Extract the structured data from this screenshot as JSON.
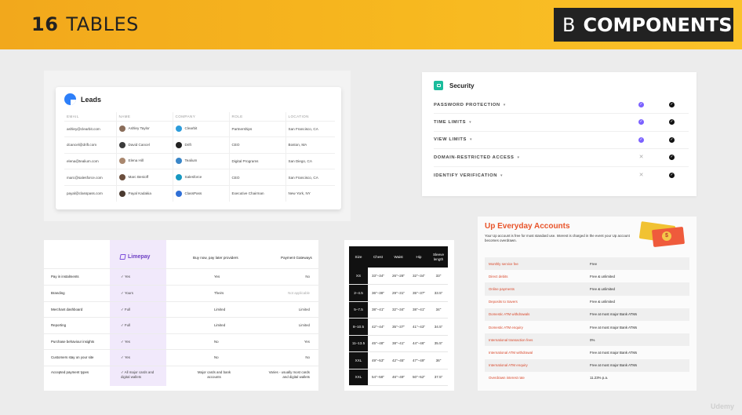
{
  "banner": {
    "number": "16",
    "title": "TABLES",
    "section_letter": "B",
    "section_title": "COMPONENTS",
    "accent": "#f5b01d"
  },
  "leads": {
    "title": "Leads",
    "columns": [
      "EMAIL",
      "NAME",
      "COMPANY",
      "ROLE",
      "LOCATION"
    ],
    "rows": [
      {
        "email": "ashley@clearbit.com",
        "name": "Ashley Taylor",
        "company": "Clearbit",
        "role": "Partnerships",
        "location": "San Francisco, CA",
        "logo_color": "#2d9cdb"
      },
      {
        "email": "dcancel@drift.com",
        "name": "David Cancel",
        "company": "Drift",
        "role": "CEO",
        "location": "Boston, MA",
        "logo_color": "#222222"
      },
      {
        "email": "elena@tealium.com",
        "name": "Elena Hill",
        "company": "Tealium",
        "role": "Digital Programs",
        "location": "San Diego, CA",
        "logo_color": "#3a86c8"
      },
      {
        "email": "marc@salesforce.com",
        "name": "Marc Benioff",
        "company": "Salesforce",
        "role": "CEO",
        "location": "San Francisco, CA",
        "logo_color": "#1798c1"
      },
      {
        "email": "payal@classpass.com",
        "name": "Payal Kadakia",
        "company": "ClassPass",
        "role": "Executive Chairman",
        "location": "New York, NY",
        "logo_color": "#2f6fd6"
      }
    ]
  },
  "security": {
    "title": "Security",
    "rows": [
      {
        "label": "PASSWORD PROTECTION",
        "c1": "check-purple",
        "c2": "check-black"
      },
      {
        "label": "TIME LIMITS",
        "c1": "check-purple",
        "c2": "check-black"
      },
      {
        "label": "VIEW LIMITS",
        "c1": "check-purple",
        "c2": "check-black"
      },
      {
        "label": "DOMAIN-RESTRICTED ACCESS",
        "c1": "cross",
        "c2": "check-black"
      },
      {
        "label": "IDENTIFY VERIFICATION",
        "c1": "cross",
        "c2": "check-black"
      }
    ],
    "purple": "#7b61ff"
  },
  "limepay": {
    "brand": "Limepay",
    "col2": "Buy now, pay later providers",
    "col3": "Payment Gateways",
    "rows": [
      {
        "feature": "Pay in instalments",
        "limepay": "✓ Yes",
        "bnpl": "Yes",
        "gateway": "No"
      },
      {
        "feature": "Branding",
        "limepay": "✓ Yours",
        "bnpl": "Theirs",
        "gateway": "Not applicable"
      },
      {
        "feature": "Merchant dashboard",
        "limepay": "✓ Full",
        "bnpl": "Limited",
        "gateway": "Limited"
      },
      {
        "feature": "Reporting",
        "limepay": "✓ Full",
        "bnpl": "Limited",
        "gateway": "Limited"
      },
      {
        "feature": "Purchase behaviour insights",
        "limepay": "✓ Yes",
        "bnpl": "No",
        "gateway": "Yes"
      },
      {
        "feature": "Customers stay on your site",
        "limepay": "✓ Yes",
        "bnpl": "No",
        "gateway": "No"
      },
      {
        "feature": "Accepted payment types",
        "limepay": "✓ All major cards and digital wallets",
        "bnpl": "Major cards and bank accounts",
        "gateway": "Varies - usually most cards and digital wallets"
      }
    ]
  },
  "sizes": {
    "headers": [
      "Size",
      "Chest",
      "Waist",
      "Hip",
      "Sleeve length"
    ],
    "rows": [
      [
        "XS",
        "33\"–34\"",
        "26\"–28\"",
        "32\"–34\"",
        "33\""
      ],
      [
        "2–4.5",
        "36\"–38\"",
        "29\"–31\"",
        "35\"–37\"",
        "33.5\""
      ],
      [
        "5–7.5",
        "38\"–41\"",
        "32\"–34\"",
        "38\"–41\"",
        "34\""
      ],
      [
        "8–10.5",
        "42\"–44\"",
        "35\"–37\"",
        "41\"–43\"",
        "34.5\""
      ],
      [
        "11–13.5",
        "45\"–48\"",
        "38\"–41\"",
        "44\"–46\"",
        "35.5\""
      ],
      [
        "XXL",
        "49\"–53\"",
        "42\"–45\"",
        "47\"–49\"",
        "36\""
      ],
      [
        "XXL",
        "54\"–58\"",
        "46\"–49\"",
        "50\"–52\"",
        "37.5\""
      ]
    ]
  },
  "up": {
    "title": "Up Everyday Accounts",
    "description": "Your Up account is free for most standard use. Interest is charged in the event your Up account becomes overdrawn.",
    "badge": "$",
    "rows": [
      {
        "k": "Monthly service fee",
        "v": "Free"
      },
      {
        "k": "Direct debits",
        "v": "Free & unlimited"
      },
      {
        "k": "Online payments",
        "v": "Free & unlimited"
      },
      {
        "k": "Deposits to Savers",
        "v": "Free & unlimited"
      },
      {
        "k": "Domestic ATM withdrawals",
        "v": "Free at most major Bank ATMs"
      },
      {
        "k": "Domestic ATM enquiry",
        "v": "Free at most major Bank ATMs"
      },
      {
        "k": "International transaction fees",
        "v": "0%"
      },
      {
        "k": "International ATM withdrawal",
        "v": "Free at most major Bank ATMs"
      },
      {
        "k": "International ATM enquiry",
        "v": "Free at most major Bank ATMs"
      },
      {
        "k": "Overdrawn interest rate",
        "v": "11.23% p.a."
      }
    ]
  },
  "watermark": "Udemy"
}
